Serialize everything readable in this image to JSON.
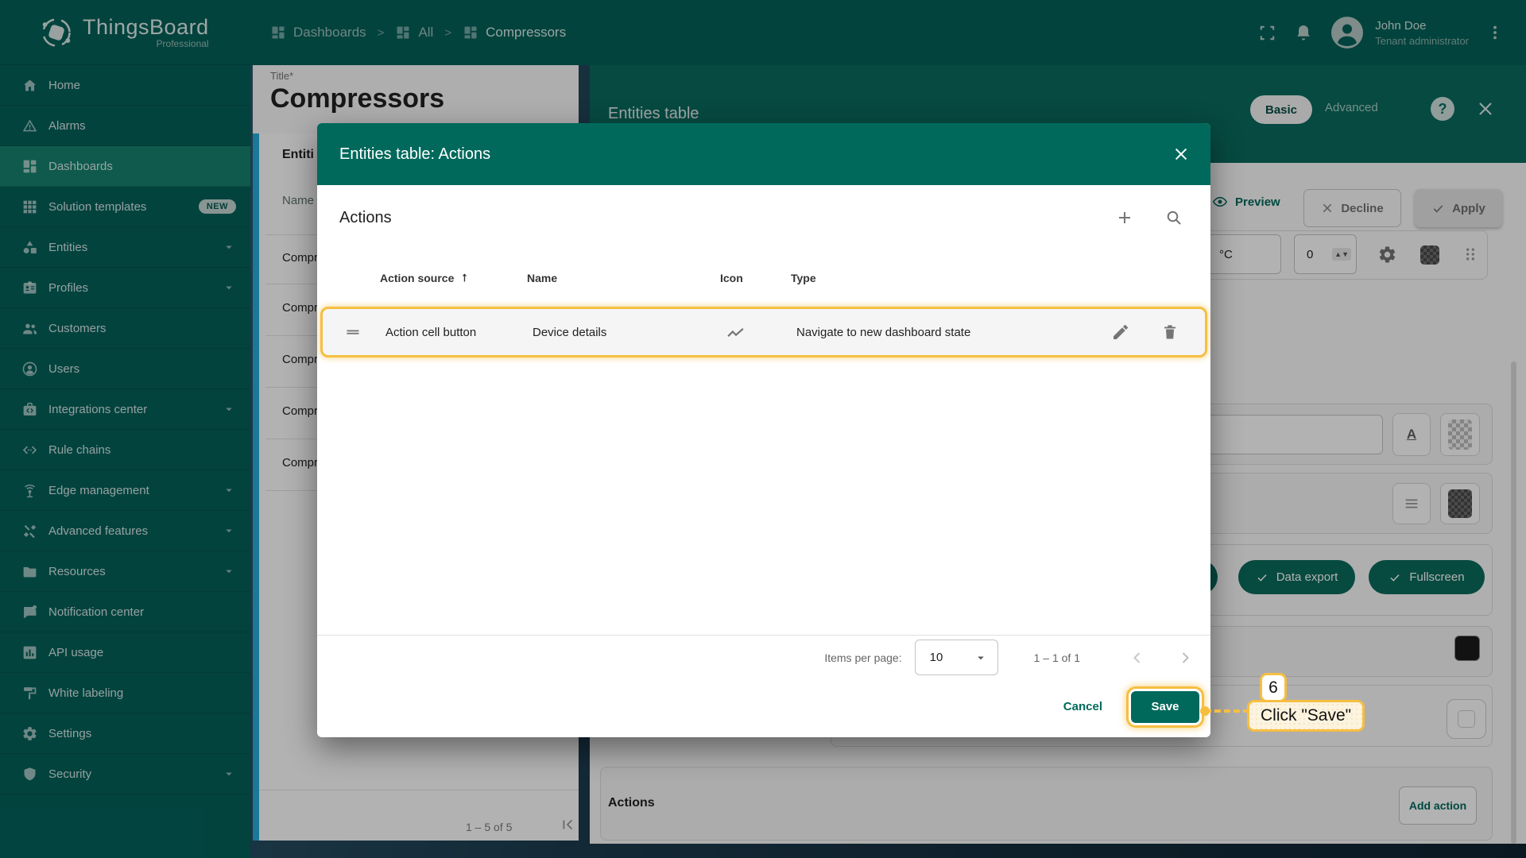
{
  "brand": {
    "name": "ThingsBoard",
    "subtitle": "Professional"
  },
  "sidebar": {
    "badge_new": "NEW",
    "items": [
      {
        "label": "Home"
      },
      {
        "label": "Alarms"
      },
      {
        "label": "Dashboards"
      },
      {
        "label": "Solution templates"
      },
      {
        "label": "Entities"
      },
      {
        "label": "Profiles"
      },
      {
        "label": "Customers"
      },
      {
        "label": "Users"
      },
      {
        "label": "Integrations center"
      },
      {
        "label": "Rule chains"
      },
      {
        "label": "Edge management"
      },
      {
        "label": "Advanced features"
      },
      {
        "label": "Resources"
      },
      {
        "label": "Notification center"
      },
      {
        "label": "API usage"
      },
      {
        "label": "White labeling"
      },
      {
        "label": "Settings"
      },
      {
        "label": "Security"
      }
    ]
  },
  "topbar": {
    "breadcrumbs": [
      {
        "label": "Dashboards"
      },
      {
        "label": "All"
      },
      {
        "label": "Compressors"
      }
    ],
    "user": {
      "name": "John Doe",
      "role": "Tenant administrator"
    }
  },
  "background": {
    "title_card": {
      "label": "Title*",
      "value": "Compressors"
    },
    "widget": {
      "title": "Entiti",
      "column_header": "Name",
      "rows": [
        "Compr",
        "Compr",
        "Compr",
        "Compr",
        "Compr"
      ],
      "range": "1 – 5 of 5"
    },
    "panel": {
      "title": "Entities table",
      "tab_basic": "Basic",
      "tab_advanced": "Advanced",
      "preview": "Preview",
      "decline": "Decline",
      "apply": "Apply",
      "unit": "°C",
      "count": "0",
      "font_button": "A",
      "chips": [
        "Data export",
        "Fullscreen"
      ],
      "actions_title": "Actions",
      "add_action": "Add action"
    }
  },
  "modal": {
    "title": "Entities table: Actions",
    "section_title": "Actions",
    "table": {
      "col_source": "Action source",
      "col_name": "Name",
      "col_icon": "Icon",
      "col_type": "Type",
      "row": {
        "source": "Action cell button",
        "name": "Device details",
        "type": "Navigate to new dashboard state"
      }
    },
    "paginator": {
      "label": "Items per page:",
      "page_size": "10",
      "range": "1 – 1 of 1"
    },
    "cancel": "Cancel",
    "save": "Save"
  },
  "annotation": {
    "step": "6",
    "text": "Click \"Save\""
  },
  "colors": {
    "teal": "#00695C",
    "sidebar": "#03615A",
    "highlight": "#F6BE41",
    "widget_border": "#26AEDA"
  }
}
